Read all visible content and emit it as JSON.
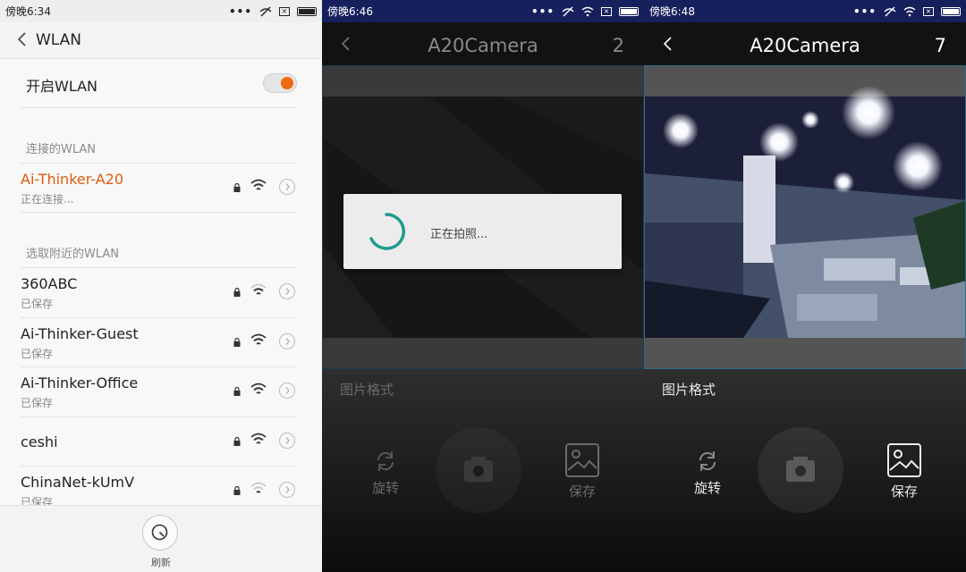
{
  "panel1": {
    "status": {
      "time": "傍晚6:34"
    },
    "nav": {
      "title": "WLAN"
    },
    "wlan_toggle": {
      "label": "开启WLAN",
      "on": true
    },
    "connected_section": "连接的WLAN",
    "connected": {
      "ssid": "Ai-Thinker-A20",
      "status": "正在连接..."
    },
    "nearby_section": "选取附近的WLAN",
    "networks": [
      {
        "ssid": "360ABC",
        "status": "已保存",
        "locked": true
      },
      {
        "ssid": "Ai-Thinker-Guest",
        "status": "已保存",
        "locked": true
      },
      {
        "ssid": "Ai-Thinker-Office",
        "status": "已保存",
        "locked": true
      },
      {
        "ssid": "ceshi",
        "status": "",
        "locked": true
      },
      {
        "ssid": "ChinaNet-kUmV",
        "status": "已保存",
        "locked": true
      }
    ],
    "refresh_label": "刷新"
  },
  "panel2": {
    "status": {
      "time": "傍晚6:46"
    },
    "title": "A20Camera",
    "count": "2",
    "dialog_text": "正在拍照...",
    "format_label": "图片格式",
    "rotate_label": "旋转",
    "save_label": "保存"
  },
  "panel3": {
    "status": {
      "time": "傍晚6:48"
    },
    "title": "A20Camera",
    "count": "7",
    "format_label": "图片格式",
    "rotate_label": "旋转",
    "save_label": "保存"
  },
  "colors": {
    "accent_orange": "#f06a0e",
    "status_bar_blue": "#16205c",
    "spinner_teal": "#1f9b8f"
  }
}
